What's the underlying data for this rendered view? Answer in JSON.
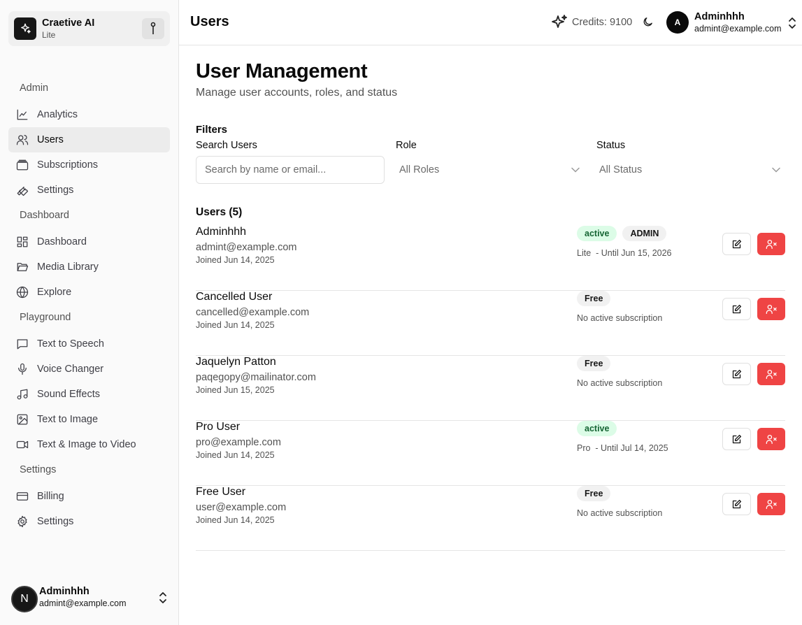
{
  "brand": {
    "name": "Craetive AI",
    "plan": "Lite"
  },
  "sidebar": {
    "groups": [
      {
        "label": "Admin",
        "items": [
          {
            "label": "Analytics",
            "icon": "chart-icon"
          },
          {
            "label": "Users",
            "icon": "users-icon",
            "active": true
          },
          {
            "label": "Subscriptions",
            "icon": "subscriptions-icon"
          },
          {
            "label": "Settings",
            "icon": "wrench-icon"
          }
        ]
      },
      {
        "label": "Dashboard",
        "items": [
          {
            "label": "Dashboard",
            "icon": "layout-icon"
          },
          {
            "label": "Media Library",
            "icon": "folder-icon"
          },
          {
            "label": "Explore",
            "icon": "globe-icon"
          }
        ]
      },
      {
        "label": "Playground",
        "items": [
          {
            "label": "Text to Speech",
            "icon": "message-icon"
          },
          {
            "label": "Voice Changer",
            "icon": "mic-icon"
          },
          {
            "label": "Sound Effects",
            "icon": "music-icon"
          },
          {
            "label": "Text to Image",
            "icon": "image-icon"
          },
          {
            "label": "Text & Image to Video",
            "icon": "video-icon"
          }
        ]
      },
      {
        "label": "Settings",
        "items": [
          {
            "label": "Billing",
            "icon": "card-icon"
          },
          {
            "label": "Settings",
            "icon": "gear-icon"
          }
        ]
      }
    ],
    "user": {
      "avatar": "N",
      "name": "Adminhhh",
      "email": "admint@example.com"
    }
  },
  "header": {
    "title": "Users",
    "credits": "Credits: 9100",
    "user": {
      "avatar": "A",
      "name": "Adminhhh",
      "email": "admint@example.com"
    }
  },
  "main": {
    "title": "User Management",
    "subtitle": "Manage user accounts, roles, and status",
    "filters": {
      "heading": "Filters",
      "search_label": "Search Users",
      "search_placeholder": "Search by name or email...",
      "search_value": "",
      "role_label": "Role",
      "role_value": "All Roles",
      "status_label": "Status",
      "status_value": "All Status"
    },
    "users_heading": "Users (5)",
    "users": [
      {
        "name": "Adminhhh",
        "email": "admint@example.com",
        "joined": "Joined Jun 14, 2025",
        "badges": [
          {
            "text": "active",
            "kind": "active"
          },
          {
            "text": "ADMIN",
            "kind": "grey"
          }
        ],
        "subscription": "Lite  - Until Jun 15, 2026"
      },
      {
        "name": "Cancelled User",
        "email": "cancelled@example.com",
        "joined": "Joined Jun 14, 2025",
        "badges": [
          {
            "text": "Free",
            "kind": "grey"
          }
        ],
        "subscription": "No active subscription"
      },
      {
        "name": "Jaquelyn Patton",
        "email": "paqegopy@mailinator.com",
        "joined": "Joined Jun 15, 2025",
        "badges": [
          {
            "text": "Free",
            "kind": "grey"
          }
        ],
        "subscription": "No active subscription"
      },
      {
        "name": "Pro User",
        "email": "pro@example.com",
        "joined": "Joined Jun 14, 2025",
        "badges": [
          {
            "text": "active",
            "kind": "active"
          }
        ],
        "subscription": "Pro  - Until Jul 14, 2025"
      },
      {
        "name": "Free User",
        "email": "user@example.com",
        "joined": "Joined Jun 14, 2025",
        "badges": [
          {
            "text": "Free",
            "kind": "grey"
          }
        ],
        "subscription": "No active subscription"
      }
    ]
  },
  "colors": {
    "danger": "#ef4444",
    "active_badge_bg": "#dcfce7",
    "active_badge_text": "#166534"
  }
}
